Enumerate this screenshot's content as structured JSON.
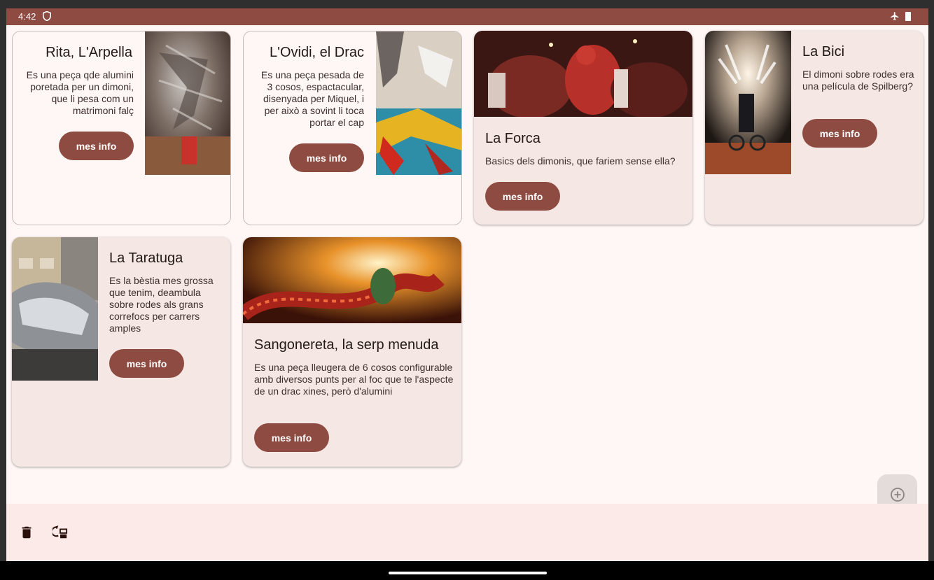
{
  "status_bar": {
    "time": "4:42",
    "icons": [
      "shield-icon",
      "airplane-mode-icon",
      "battery-icon"
    ]
  },
  "cards": [
    {
      "title": "Rita, L'Arpella",
      "description": "Es una peça qde alumini poretada per un dimoni, que li pesa com un matrimoni falç",
      "button": "mes info"
    },
    {
      "title": "L'Ovidi, el Drac",
      "description": "Es una peça pesada de 3 cosos, espactacular, disenyada per Miquel, i per això a sovint li toca portar el cap",
      "button": "mes info"
    },
    {
      "title": "La Forca",
      "description": "Basics dels dimonis, que fariem sense ella?",
      "button": "mes info"
    },
    {
      "title": "La Bici",
      "description": "El dimoni sobre rodes era una película de Spilberg?",
      "button": "mes info"
    },
    {
      "title": "La Taratuga",
      "description": "Es la bèstia mes grossa que tenim, deambula sobre rodes als grans correfocs per carrers amples",
      "button": "mes info"
    },
    {
      "title": "Sangonereta, la serp menuda",
      "description": "Es una peça lleugera de 6 cosos configurable amb diversos punts per al foc que te l'aspecte de un drac xines, però d'alumini",
      "button": "mes info"
    }
  ],
  "fab": {
    "icon": "add-circle-icon"
  },
  "bottom_bar": {
    "icons": [
      "delete-icon",
      "refresh-list-icon"
    ]
  },
  "colors": {
    "primary": "#8e4b41",
    "background": "#fff7f5",
    "card_elevated": "#f4e7e4",
    "bottom_bar": "#fbeae7"
  }
}
